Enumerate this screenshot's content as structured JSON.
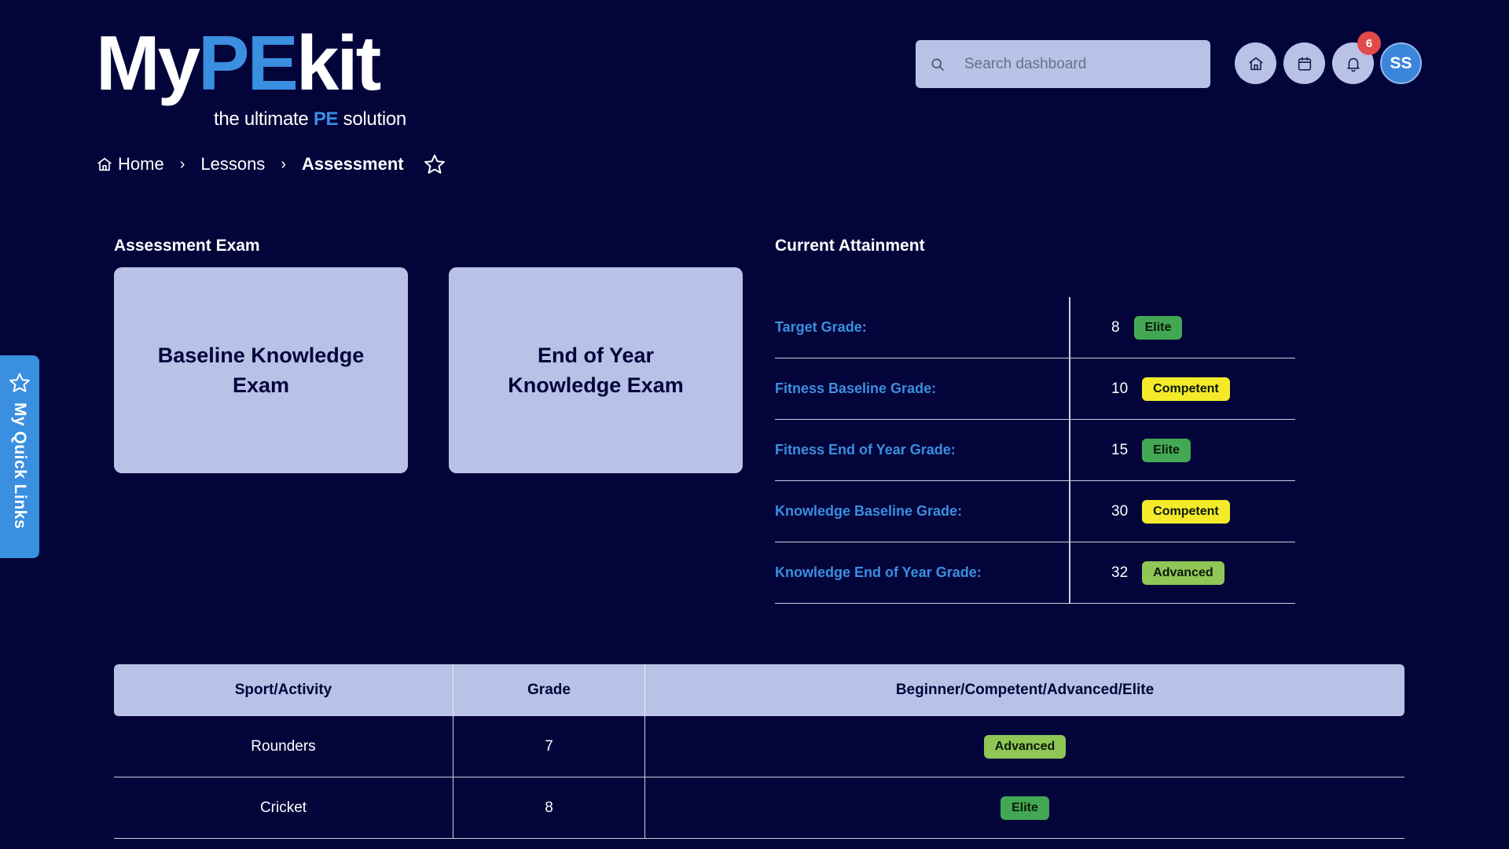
{
  "header": {
    "logo": {
      "my": "My",
      "pe": "PE",
      "kit": "kit",
      "tagline_prefix": "the ultimate ",
      "tagline_pe": "PE",
      "tagline_suffix": " solution"
    },
    "search_placeholder": "Search dashboard",
    "notification_count": "6",
    "avatar_initials": "SS",
    "icons": [
      "search-icon",
      "home-icon",
      "calendar-icon",
      "bell-icon"
    ]
  },
  "breadcrumb": {
    "home": "Home",
    "lessons": "Lessons",
    "current": "Assessment",
    "separator": "›"
  },
  "assessment_exam": {
    "title": "Assessment Exam",
    "cards": [
      "Baseline Knowledge Exam",
      "End of Year Knowledge Exam"
    ]
  },
  "current_attainment": {
    "title": "Current Attainment",
    "rows": [
      {
        "label": "Target Grade:",
        "value": "8",
        "level": "Elite"
      },
      {
        "label": "Fitness Baseline Grade:",
        "value": "10",
        "level": "Competent"
      },
      {
        "label": "Fitness End of Year Grade:",
        "value": "15",
        "level": "Elite"
      },
      {
        "label": "Knowledge Baseline Grade:",
        "value": "30",
        "level": "Competent"
      },
      {
        "label": "Knowledge End of Year Grade:",
        "value": "32",
        "level": "Advanced"
      }
    ]
  },
  "sport_table": {
    "headers": [
      "Sport/Activity",
      "Grade",
      "Beginner/Competent/Advanced/Elite"
    ],
    "rows": [
      {
        "sport": "Rounders",
        "grade": "7",
        "level": "Advanced"
      },
      {
        "sport": "Cricket",
        "grade": "8",
        "level": "Elite"
      }
    ]
  },
  "quick_links": {
    "label": "My Quick Links"
  },
  "colors": {
    "background": "#03043a",
    "accent_blue": "#3a8fe0",
    "card_bg": "#b8c2e6",
    "elite": "#43a853",
    "competent": "#f4ea2a",
    "advanced": "#8fc655",
    "badge_red": "#e24a4a"
  }
}
